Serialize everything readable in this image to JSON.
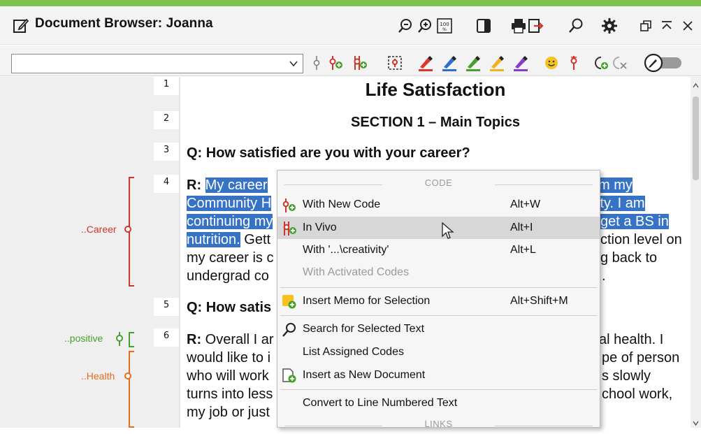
{
  "window": {
    "title": "Document Browser: Joanna"
  },
  "colors": {
    "accent_green": "#7cc24a",
    "selection": "#3773c4",
    "career": "#d0342c",
    "health": "#e56b1f",
    "positive": "#45a12c"
  },
  "titlebar_icons": [
    "zoom-out-icon",
    "zoom-in-icon",
    "zoom-100-icon",
    "panel-toggle-icon",
    "print-icon",
    "export-icon",
    "search-icon",
    "settings-icon",
    "restore-icon",
    "collapse-icon",
    "close-icon"
  ],
  "toolbar_icons": [
    "code-icon",
    "new-code-icon",
    "in-vivo-icon",
    "select-region-icon",
    "highlighter-red-icon",
    "highlighter-blue-icon",
    "highlighter-green-icon",
    "highlighter-yellow-icon",
    "highlighter-purple-icon",
    "emoticon-icon",
    "symbol-code-icon",
    "assign-codes-icon",
    "remove-codes-icon",
    "edit-mode-toggle"
  ],
  "document": {
    "line_numbers": [
      "1",
      "2",
      "3",
      "4",
      "5",
      "6"
    ],
    "title": "Life Satisfaction",
    "section": "SECTION 1 – Main Topics",
    "q1": "Q: How satisfied are you with your career?",
    "r1_prefix": "R: ",
    "r1_line1": "My career",
    "r1_line1_right": "m my",
    "r1_line2": "Community H",
    "r1_line2_right": "ity. I am",
    "r1_line3": "continuing my",
    "r1_line3_right": "get a BS in",
    "r1_line4_sel": "nutrition.",
    "r1_line4_rest": " Gett",
    "r1_line4_right": "ction level on",
    "r1_line5": "my career is c",
    "r1_line5_right": "g back to",
    "r1_line6": "undergrad co",
    "r1_line6_right": ".",
    "q2": "Q: How satis",
    "r2_prefix": "R: ",
    "r2_line1": "Overall I ar",
    "r2_line1_right": "al health. I",
    "r2_line2": "would like to i",
    "r2_line2_right": "pe of person",
    "r2_line3": "who will work",
    "r2_line3_right": "s slowly",
    "r2_line4": "turns into less",
    "r2_line4_right": "chool work,",
    "r2_line5": "my job or just"
  },
  "codes": {
    "career": "..Career",
    "positive": "..positive",
    "health": "..Health"
  },
  "context_menu": {
    "header_code": "CODE",
    "header_links": "LINKS",
    "items": [
      {
        "label": "With New Code",
        "shortcut": "Alt+W"
      },
      {
        "label": "In Vivo",
        "shortcut": "Alt+I"
      },
      {
        "label": "With '...\\creativity'",
        "shortcut": "Alt+L"
      },
      {
        "label": "With Activated Codes",
        "shortcut": ""
      },
      {
        "label": "Insert Memo for Selection",
        "shortcut": "Alt+Shift+M"
      },
      {
        "label": "Search for Selected Text",
        "shortcut": ""
      },
      {
        "label": "List Assigned Codes",
        "shortcut": ""
      },
      {
        "label": "Insert as New Document",
        "shortcut": ""
      },
      {
        "label": "Convert to Line Numbered Text",
        "shortcut": ""
      }
    ]
  }
}
